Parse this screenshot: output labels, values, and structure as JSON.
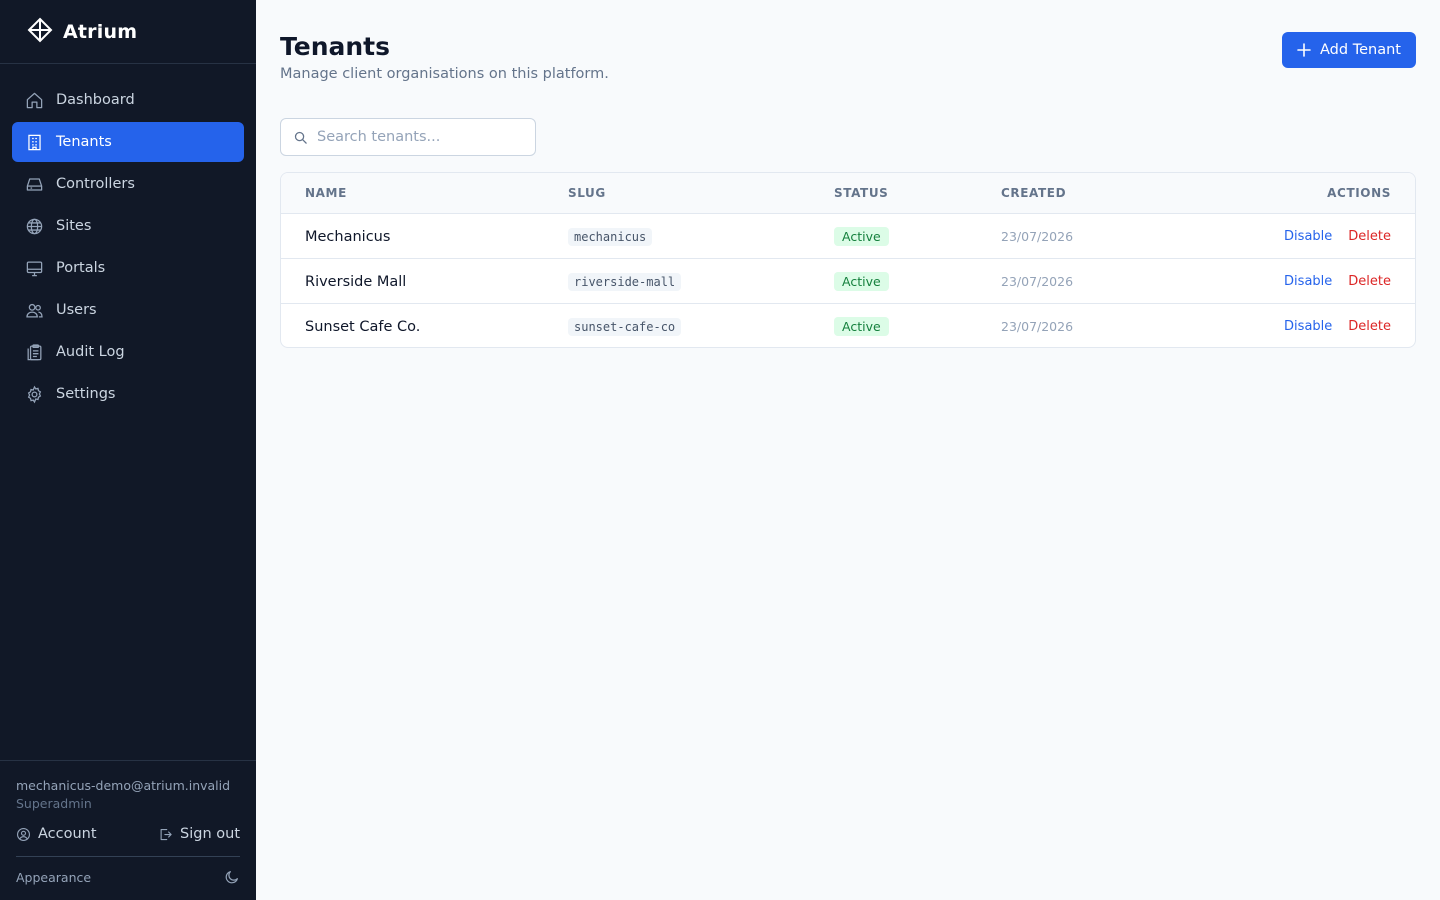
{
  "app": {
    "name": "Atrium"
  },
  "sidebar": {
    "items": [
      {
        "label": "Dashboard",
        "icon": "home-icon",
        "active": false
      },
      {
        "label": "Tenants",
        "icon": "building-icon",
        "active": true
      },
      {
        "label": "Controllers",
        "icon": "hard-drive-icon",
        "active": false
      },
      {
        "label": "Sites",
        "icon": "globe-icon",
        "active": false
      },
      {
        "label": "Portals",
        "icon": "monitor-icon",
        "active": false
      },
      {
        "label": "Users",
        "icon": "users-icon",
        "active": false
      },
      {
        "label": "Audit Log",
        "icon": "clipboard-icon",
        "active": false
      },
      {
        "label": "Settings",
        "icon": "gear-icon",
        "active": false
      }
    ],
    "user": {
      "email": "mechanicus-demo@atrium.invalid",
      "role": "Superadmin"
    },
    "account_label": "Account",
    "signout_label": "Sign out",
    "appearance_label": "Appearance"
  },
  "page": {
    "title": "Tenants",
    "subtitle": "Manage client organisations on this platform.",
    "add_button_label": "Add Tenant"
  },
  "search": {
    "placeholder": "Search tenants...",
    "value": ""
  },
  "table": {
    "columns": [
      "NAME",
      "SLUG",
      "STATUS",
      "CREATED",
      "ACTIONS"
    ],
    "rows": [
      {
        "name": "Mechanicus",
        "slug": "mechanicus",
        "status": "Active",
        "created": "23/07/2026",
        "action_disable": "Disable",
        "action_delete": "Delete"
      },
      {
        "name": "Riverside Mall",
        "slug": "riverside-mall",
        "status": "Active",
        "created": "23/07/2026",
        "action_disable": "Disable",
        "action_delete": "Delete"
      },
      {
        "name": "Sunset Cafe Co.",
        "slug": "sunset-cafe-co",
        "status": "Active",
        "created": "23/07/2026",
        "action_disable": "Disable",
        "action_delete": "Delete"
      }
    ]
  },
  "colors": {
    "sidebar_bg": "#111827",
    "accent": "#2563eb",
    "status_active_bg": "#dcfce7",
    "status_active_text": "#15803d",
    "danger": "#dc2626"
  }
}
